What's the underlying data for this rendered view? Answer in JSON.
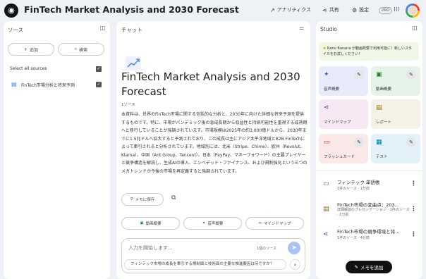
{
  "app": {
    "title": "FinTech Market Analysis and 2030 Forecast"
  },
  "topbar": {
    "analytics": "アナリティクス",
    "share": "共有",
    "settings": "設定",
    "pro_badge": "PRO"
  },
  "sources": {
    "heading": "ソース",
    "add_label": "追加",
    "search_label": "検索",
    "select_all": "Select all sources",
    "items": [
      {
        "label": "FinTech市場分析と将来予測"
      }
    ]
  },
  "chat": {
    "heading": "チャット",
    "note_title": "FinTech Market Analysis and 2030 Forecast",
    "source_count": "1ソース",
    "body": "本資料は、世界のFinTech市場に関する包括的な分析と、2030年に向けた詳細な将来予測を提供するものです。特に、市場がパンデミック後の急成長期から収益性と持続可能性を重視する成熟期へと移行していることが強調されています。市場規模は2025年の約3,000億ドルから、2030年までに1.5兆ドルへ拡大すると予測されており、この成長は主にアジア太平洋地域とB2B FinTechによって牽引されると分析されています。地域別には、北米（Stripe、Chime）、欧州（Revolut、Klarna）、中国（Ant Group、Tencent）、日本（PayPay、マネーフォワード）の主要プレイヤーと競争構造を解説し、生成AIの導入、エンベデッド・ファイナンス、および規制強化という三つのメガトレンドが今後の市場を再定義すると強調されています。",
    "save_note": "メモに保存",
    "actions": [
      "動画概要",
      "音声概要",
      "マインドマップ"
    ],
    "input_placeholder": "入力を開始します...",
    "input_source_count": "1個のソース",
    "suggestion": "フィンテック市場の成長を牽引する規制面と技術面の主要な推進要因は何ですか？"
  },
  "studio": {
    "heading": "Studio",
    "banner": "Nano Banana が動画概要で利用可能に！新しいスタイルをお試しください！",
    "tiles": [
      {
        "label": "音声概要",
        "icon": "sparkle-icon",
        "color": "#e8ebfa"
      },
      {
        "label": "動画概要",
        "icon": "video-icon",
        "color": "#e6f3ea"
      },
      {
        "label": "マインドマップ",
        "icon": "mindmap-icon",
        "color": "#f6e9f3"
      },
      {
        "label": "レポート",
        "icon": "report-icon",
        "color": "#f4f2e6"
      },
      {
        "label": "フラッシュカード",
        "icon": "flashcard-icon",
        "color": "#fbe9e9"
      },
      {
        "label": "テスト",
        "icon": "quiz-icon",
        "color": "#e3f1f8"
      }
    ],
    "notes": [
      {
        "title": "フィンテック 単語帳",
        "sub": "1件のソース · 1分前",
        "icon": "flashcard-icon"
      },
      {
        "title": "FinTech市場の変曲点：203…",
        "sub": "詳細解説のプレゼンテーション · 1件のソース · 1分前",
        "icon": "report-icon"
      },
      {
        "title": "FinTech市場の競争環境と将…",
        "sub": "1件のソース · 4分前",
        "icon": "mindmap-icon"
      }
    ],
    "add_note": "メモを追加"
  },
  "colors": {
    "accent": "#4285f4",
    "page_bg": "#eef1f5"
  }
}
